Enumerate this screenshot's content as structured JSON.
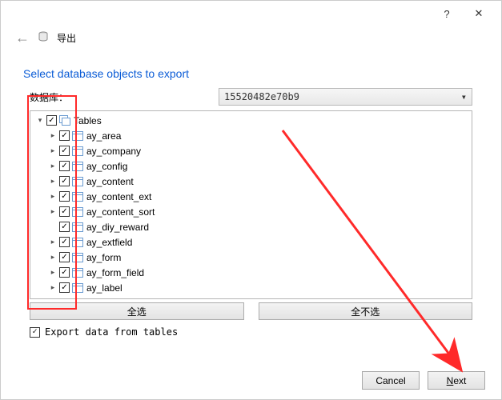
{
  "titlebar": {
    "help_icon": "?",
    "close_icon": "✕"
  },
  "header": {
    "back_glyph": "←",
    "title": "导出"
  },
  "instruction": "Select database objects to export",
  "database": {
    "label": "数据库：",
    "selected": "15520482e70b9",
    "dropdown_glyph": "▾"
  },
  "tree": {
    "root": {
      "expander": "▾",
      "checked": true,
      "label": "Tables"
    },
    "items": [
      {
        "expander": "▸",
        "checked": true,
        "label": "ay_area"
      },
      {
        "expander": "▸",
        "checked": true,
        "label": "ay_company"
      },
      {
        "expander": "▸",
        "checked": true,
        "label": "ay_config"
      },
      {
        "expander": "▸",
        "checked": true,
        "label": "ay_content"
      },
      {
        "expander": "▸",
        "checked": true,
        "label": "ay_content_ext"
      },
      {
        "expander": "▸",
        "checked": true,
        "label": "ay_content_sort"
      },
      {
        "expander": "",
        "checked": true,
        "label": "ay_diy_reward"
      },
      {
        "expander": "▸",
        "checked": true,
        "label": "ay_extfield"
      },
      {
        "expander": "▸",
        "checked": true,
        "label": "ay_form"
      },
      {
        "expander": "▸",
        "checked": true,
        "label": "ay_form_field"
      },
      {
        "expander": "▸",
        "checked": true,
        "label": "ay_label"
      }
    ]
  },
  "buttons": {
    "select_all": "全选",
    "select_none": "全不选"
  },
  "export_tables": {
    "checked": true,
    "label": "Export data from tables"
  },
  "footer": {
    "cancel": "Cancel",
    "next_u": "N",
    "next_rest": "ext"
  },
  "check_glyph": "✓"
}
